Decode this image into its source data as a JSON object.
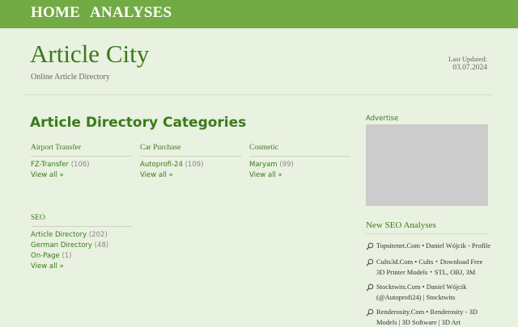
{
  "nav": {
    "home": "HOME",
    "analyses": "ANALYSES"
  },
  "header": {
    "title": "Article City",
    "tagline": "Online Article Directory",
    "updated_label": "Last Updated:",
    "updated_date": "03.07.2024"
  },
  "main": {
    "heading": "Article Directory Categories",
    "categories": [
      {
        "title": "Airport Transfer",
        "items": [
          {
            "name": "FZ-Transfer",
            "count": "(106)"
          }
        ],
        "view_all": "View all »"
      },
      {
        "title": "Car Purchase",
        "items": [
          {
            "name": "Autoprofi-24",
            "count": "(109)"
          }
        ],
        "view_all": "View all »"
      },
      {
        "title": "Cosmetic",
        "items": [
          {
            "name": "Maryam",
            "count": "(99)"
          }
        ],
        "view_all": "View all »"
      },
      {
        "title": "SEO",
        "items": [
          {
            "name": "Article Directory",
            "count": "(202)"
          },
          {
            "name": "German Directory",
            "count": "(48)"
          },
          {
            "name": "On-Page",
            "count": "(1)"
          }
        ],
        "view_all": "View all »"
      }
    ]
  },
  "sidebar": {
    "advertise_label": "Advertise",
    "seo_heading": "New SEO Analyses",
    "analyses": [
      "Topsitenet.Com • Daniel Wójcik - Profile",
      "Cults3d.Com • Cults・Download Free 3D Printer Models・STL, OBJ, 3M",
      "Stocktwits.Com • Daniel Wójcik (@Autoprofi24) | Stocktwits",
      "Renderosity.Com • Renderosity - 3D Models | 3D Software | 3D Art"
    ]
  },
  "colors": {
    "nav_bg": "#72aa44",
    "page_bg": "#e9f1e0",
    "accent_green": "#3a7a1c",
    "ad_placeholder": "#cccccc"
  }
}
